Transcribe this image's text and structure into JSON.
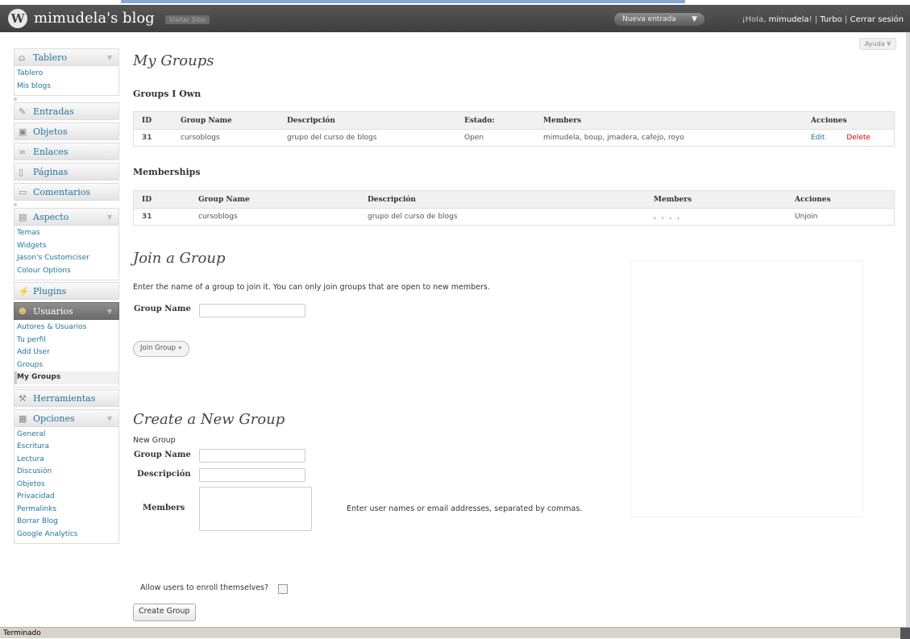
{
  "header": {
    "site_title": "mimudela's blog",
    "visit_site": "Visitar Sitio",
    "new_entry": "Nueva entrada",
    "greeting_prefix": "¡Hola, ",
    "username": "mimudela",
    "greeting_suffix": "!",
    "turbo": "Turbo",
    "logout": "Cerrar sesión",
    "help": "Ayuda ¥"
  },
  "sidebar": {
    "tablero": {
      "label": "Tablero",
      "items": [
        "Tablero",
        "Mis blogs"
      ]
    },
    "entradas": "Entradas",
    "objetos": "Objetos",
    "enlaces": "Enlaces",
    "paginas": "Páginas",
    "comentarios": "Comentarios",
    "aspecto": {
      "label": "Aspecto",
      "items": [
        "Temas",
        "Widgets",
        "Jason's Customciser",
        "Colour Options"
      ]
    },
    "plugins": "Plugins",
    "usuarios": {
      "label": "Usuarios",
      "items": [
        "Autores & Usuarios",
        "Tu perfil",
        "Add User",
        "Groups",
        "My Groups"
      ]
    },
    "herramientas": "Herramientas",
    "opciones": {
      "label": "Opciones",
      "items": [
        "General",
        "Escritura",
        "Lectura",
        "Discusión",
        "Objetos",
        "Privacidad",
        "Permalinks",
        "Borrar Blog",
        "Google Analytics"
      ]
    }
  },
  "page": {
    "title": "My Groups",
    "groups_i_own": {
      "heading": "Groups I Own",
      "columns": [
        "ID",
        "Group Name",
        "Descripción",
        "Estado:",
        "Members",
        "Acciones"
      ],
      "rows": [
        {
          "id": "31",
          "name": "cursoblogs",
          "description": "grupo del curso de blogs",
          "status": "Open",
          "members": "mimudela, boup, jmadera, cafejo, royo",
          "edit": "Edit",
          "delete": "Delete"
        }
      ]
    },
    "memberships": {
      "heading": "Memberships",
      "columns": [
        "ID",
        "Group Name",
        "Descripción",
        "Members",
        "Acciones"
      ],
      "rows": [
        {
          "id": "31",
          "name": "cursoblogs",
          "description": "grupo del curso de blogs",
          "members": ", , , ,",
          "action": "Unjoin"
        }
      ]
    },
    "join": {
      "title": "Join a Group",
      "text": "Enter the name of a group to join it. You can only join groups that are open to new members.",
      "group_name_label": "Group Name",
      "group_name_value": "",
      "button": "Join Group »"
    },
    "create": {
      "title": "Create a New Group",
      "subtitle": "New Group",
      "group_name_label": "Group Name",
      "description_label": "Descripción",
      "members_label": "Members",
      "members_hint": "Enter user names or email addresses, separated by commas.",
      "enroll_label": "Allow users to enroll themselves?",
      "enroll_checked": false,
      "button": "Create Group"
    }
  },
  "statusbar": {
    "text": "Terminado"
  }
}
